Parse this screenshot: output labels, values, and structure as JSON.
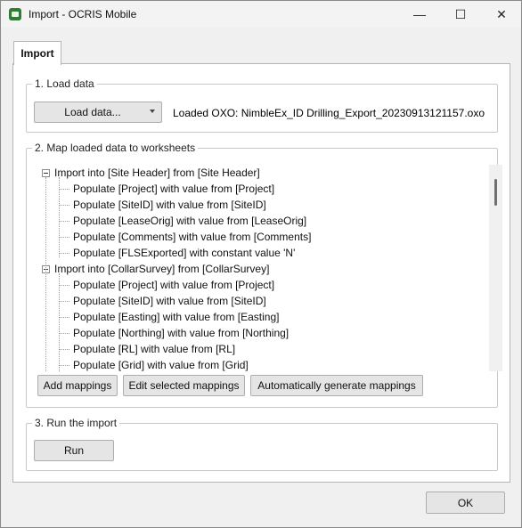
{
  "window": {
    "title": "Import - OCRIS Mobile",
    "minimize_glyph": "—",
    "maximize_glyph": "☐",
    "close_glyph": "✕"
  },
  "tabs": [
    {
      "label": "Import"
    }
  ],
  "load_section": {
    "label": "1. Load data",
    "load_button": "Load data...",
    "loaded_text": "Loaded OXO: NimbleEx_ID Drilling_Export_20230913121157.oxo"
  },
  "map_section": {
    "label": "2. Map loaded data to worksheets",
    "tree": [
      {
        "level": 0,
        "text": "Import into [Site Header] from [Site Header]"
      },
      {
        "level": 1,
        "text": "Populate [Project] with value from [Project]"
      },
      {
        "level": 1,
        "text": "Populate [SiteID] with value from [SiteID]"
      },
      {
        "level": 1,
        "text": "Populate [LeaseOrig] with value from [LeaseOrig]"
      },
      {
        "level": 1,
        "text": "Populate [Comments] with value from [Comments]"
      },
      {
        "level": 1,
        "text": "Populate [FLSExported] with constant value 'N'"
      },
      {
        "level": 0,
        "text": "Import into [CollarSurvey] from [CollarSurvey]"
      },
      {
        "level": 1,
        "text": "Populate [Project] with value from [Project]"
      },
      {
        "level": 1,
        "text": "Populate [SiteID] with value from [SiteID]"
      },
      {
        "level": 1,
        "text": "Populate [Easting] with value from [Easting]"
      },
      {
        "level": 1,
        "text": "Populate [Northing] with value from [Northing]"
      },
      {
        "level": 1,
        "text": "Populate [RL] with value from [RL]"
      },
      {
        "level": 1,
        "text": "Populate [Grid] with value from [Grid]"
      }
    ],
    "buttons": {
      "add": "Add mappings",
      "edit": "Edit selected mappings",
      "auto": "Automatically generate mappings"
    }
  },
  "run_section": {
    "label": "3. Run the import",
    "run_button": "Run"
  },
  "ok_button": "OK"
}
